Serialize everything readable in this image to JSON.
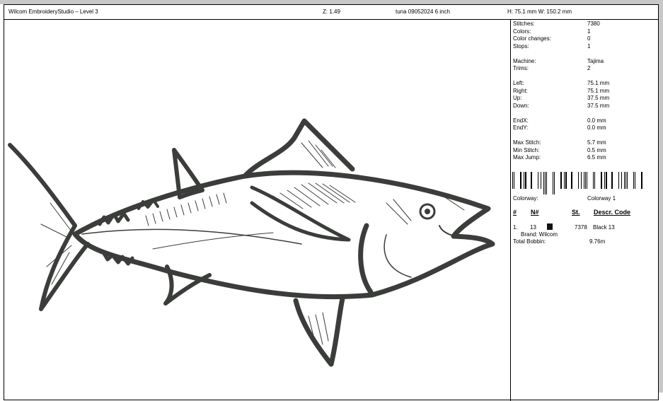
{
  "header": {
    "app_title": "Wilcom EmbroideryStudio – Level 3",
    "zoom": "Z: 1.49",
    "design_name": "tuna 09052024 6 inch",
    "dimensions": "H: 75.1 mm   W: 150.2 mm"
  },
  "stats": [
    {
      "label": "Stitches:",
      "value": "7380"
    },
    {
      "label": "Colors:",
      "value": "1"
    },
    {
      "label": "Color changes:",
      "value": "0"
    },
    {
      "label": "Stops:",
      "value": "1"
    },
    {
      "label": "Machine:",
      "value": "Tajima"
    },
    {
      "label": "Trims:",
      "value": "2"
    },
    {
      "label": "Left:",
      "value": "75.1 mm"
    },
    {
      "label": "Right:",
      "value": "75.1 mm"
    },
    {
      "label": "Up:",
      "value": "37.5 mm"
    },
    {
      "label": "Down:",
      "value": "37.5 mm"
    },
    {
      "label": "EndX:",
      "value": "0.0 mm"
    },
    {
      "label": "EndY:",
      "value": "0.0 mm"
    },
    {
      "label": "Max Stitch:",
      "value": "5.7 mm"
    },
    {
      "label": "Min Stitch:",
      "value": "0.5 mm"
    },
    {
      "label": "Max Jump:",
      "value": "6.5 mm"
    }
  ],
  "colorway": {
    "label": "Colorway:",
    "value": "Colorway 1"
  },
  "table": {
    "headers": [
      "#",
      "N#",
      "St.",
      "Descr. Code"
    ],
    "row": {
      "index": "1.",
      "number": "13",
      "swatch_color": "#111111",
      "stitches": "7378",
      "descr": "Black 13",
      "brand": "Brand: Wilcom"
    }
  },
  "total_bobbin": {
    "label": "Total Bobbin:",
    "value": "9.76m"
  },
  "colors": {
    "thread": "#3a3d39",
    "frame": "#c8c8c8"
  }
}
